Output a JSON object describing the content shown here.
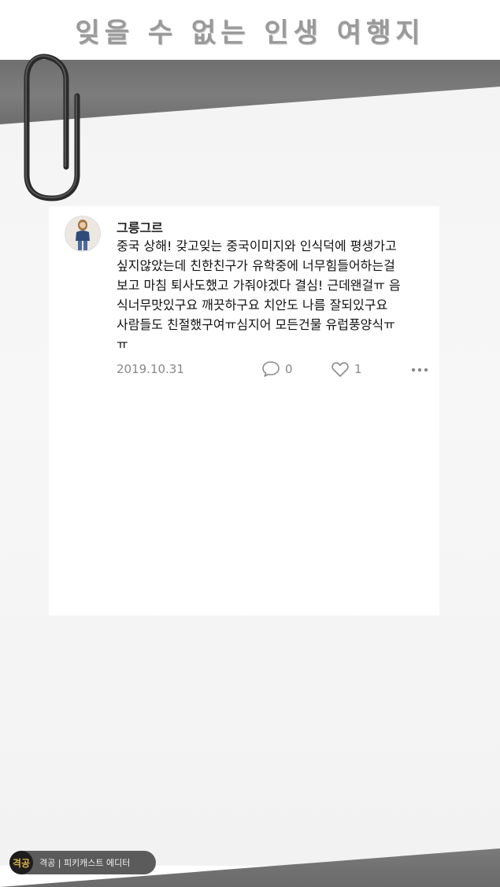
{
  "header": {
    "title": "잊을 수 없는 인생 여행지"
  },
  "post": {
    "username": "그릉그르",
    "content": "중국 상해! 갖고잊는 중국이미지와 인식덕에 평생가고\n싶지않았는데 친한친구가 유학중에 너무힘들어하는걸\n보고 마침 퇴사도했고 가줘야겠다 결심! 근데왠걸ㅠ 음\n식너무맛있구요 깨끗하구요 치안도 나름 잘되있구요\n사람들도 친절했구여ㅠ심지어 모든건물 유럽풍양식ㅠ\nㅠ",
    "date": "2019.10.31",
    "comment_count": "0",
    "like_count": "1",
    "icons": {
      "comment": "comment-icon",
      "like": "heart-icon",
      "more": "more-dots-icon"
    }
  },
  "watermark": {
    "logo_text": "격공",
    "text": "격공 | 피키캐스트 에디터"
  }
}
